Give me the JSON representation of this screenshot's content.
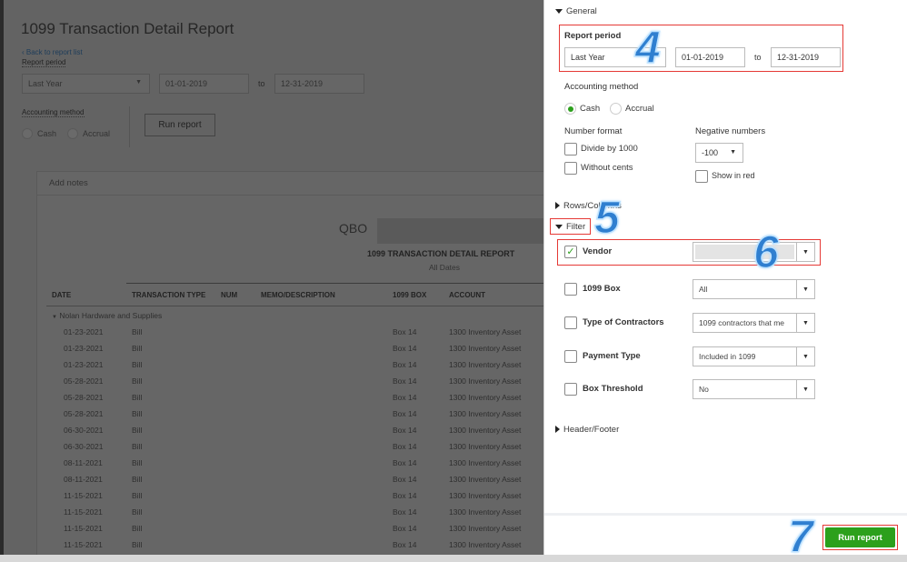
{
  "report": {
    "title": "1099 Transaction Detail Report",
    "back_link": "Back to report list",
    "report_period_label": "Report period",
    "period_value": "Last Year",
    "start_date": "01-01-2019",
    "to": "to",
    "end_date": "12-31-2019",
    "accounting_method_label": "Accounting method",
    "cash": "Cash",
    "accrual": "Accrual",
    "run_report": "Run report",
    "add_notes": "Add notes",
    "company_prefix": "QBO",
    "report_heading": "1099 TRANSACTION DETAIL REPORT",
    "report_dates": "All Dates",
    "columns": [
      "DATE",
      "TRANSACTION TYPE",
      "NUM",
      "MEMO/DESCRIPTION",
      "1099 BOX",
      "ACCOUNT"
    ],
    "group": "Nolan Hardware and Supplies",
    "rows": [
      [
        "01-23-2021",
        "Bill",
        "Box 14",
        "1300 Inventory Asset"
      ],
      [
        "01-23-2021",
        "Bill",
        "Box 14",
        "1300 Inventory Asset"
      ],
      [
        "01-23-2021",
        "Bill",
        "Box 14",
        "1300 Inventory Asset"
      ],
      [
        "05-28-2021",
        "Bill",
        "Box 14",
        "1300 Inventory Asset"
      ],
      [
        "05-28-2021",
        "Bill",
        "Box 14",
        "1300 Inventory Asset"
      ],
      [
        "05-28-2021",
        "Bill",
        "Box 14",
        "1300 Inventory Asset"
      ],
      [
        "06-30-2021",
        "Bill",
        "Box 14",
        "1300 Inventory Asset"
      ],
      [
        "06-30-2021",
        "Bill",
        "Box 14",
        "1300 Inventory Asset"
      ],
      [
        "08-11-2021",
        "Bill",
        "Box 14",
        "1300 Inventory Asset"
      ],
      [
        "08-11-2021",
        "Bill",
        "Box 14",
        "1300 Inventory Asset"
      ],
      [
        "11-15-2021",
        "Bill",
        "Box 14",
        "1300 Inventory Asset"
      ],
      [
        "11-15-2021",
        "Bill",
        "Box 14",
        "1300 Inventory Asset"
      ],
      [
        "11-15-2021",
        "Bill",
        "Box 14",
        "1300 Inventory Asset"
      ],
      [
        "11-15-2021",
        "Bill",
        "Box 14",
        "1300 Inventory Asset"
      ]
    ]
  },
  "panel": {
    "general": "General",
    "report_period": "Report period",
    "period_value": "Last Year",
    "start_date": "01-01-2019",
    "to": "to",
    "end_date": "12-31-2019",
    "accounting_method": "Accounting method",
    "cash": "Cash",
    "accrual": "Accrual",
    "accounting_selected": "Cash",
    "number_format": "Number format",
    "divide_by_1000": "Divide by 1000",
    "without_cents": "Without cents",
    "negative_numbers": "Negative numbers",
    "negative_value": "-100",
    "show_in_red": "Show in red",
    "rows_columns": "Rows/Columns",
    "filter": "Filter",
    "filters": [
      {
        "label": "Vendor",
        "value": "",
        "checked": true
      },
      {
        "label": "1099 Box",
        "value": "All",
        "checked": false
      },
      {
        "label": "Type of Contractors",
        "value": "1099 contractors that me",
        "checked": false
      },
      {
        "label": "Payment Type",
        "value": "Included in 1099",
        "checked": false
      },
      {
        "label": "Box Threshold",
        "value": "No",
        "checked": false
      }
    ],
    "header_footer": "Header/Footer",
    "run_report": "Run report"
  },
  "annotations": [
    "4",
    "5",
    "6",
    "7"
  ],
  "colors": {
    "accent_green": "#2ca01c",
    "highlight_red": "#e53935",
    "annotation_blue": "#2f7fd0"
  }
}
